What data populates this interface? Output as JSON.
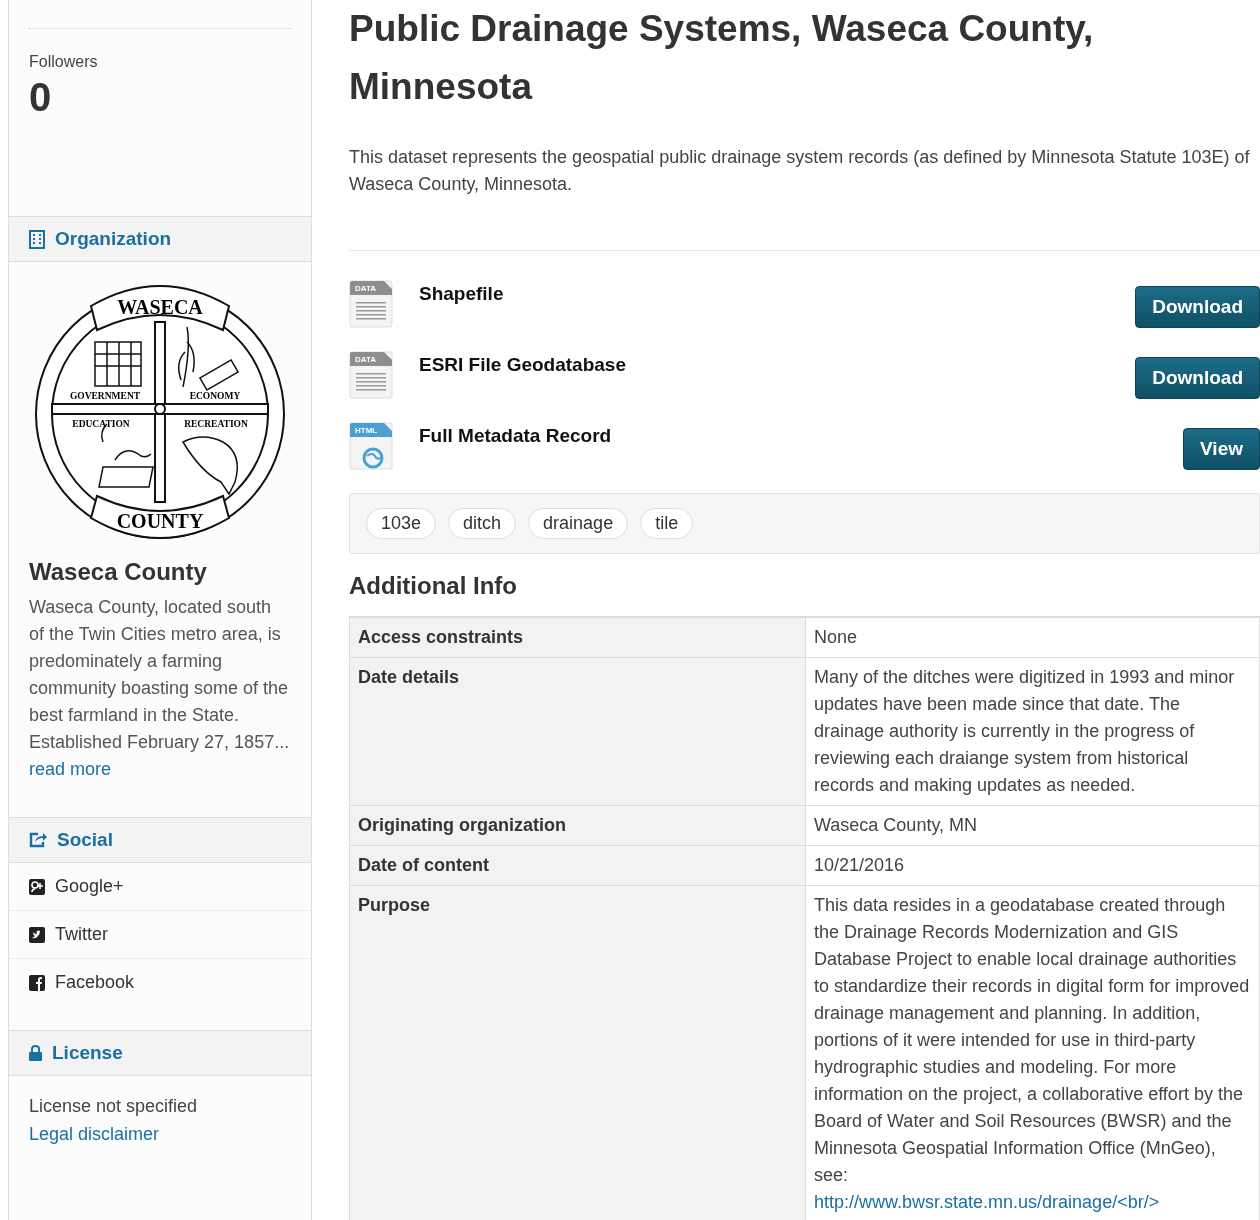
{
  "sidebar": {
    "followers": {
      "label": "Followers",
      "count": "0"
    },
    "organization": {
      "heading": "Organization",
      "seal": {
        "top": "WASECA",
        "bottom": "COUNTY",
        "quadrants": [
          "GOVERNMENT",
          "ECONOMY",
          "EDUCATION",
          "RECREATION"
        ]
      },
      "name": "Waseca County",
      "description": "Waseca County, located south of the Twin Cities metro area, is predominately a farming community boasting some of the best farmland in the State. Established February 27, 1857...",
      "more_link": "read more"
    },
    "social": {
      "heading": "Social",
      "items": [
        {
          "kind": "googleplus",
          "label": "Google+"
        },
        {
          "kind": "twitter",
          "label": "Twitter"
        },
        {
          "kind": "facebook",
          "label": "Facebook"
        }
      ]
    },
    "license": {
      "heading": "License",
      "text": "License not specified",
      "link": "Legal disclaimer"
    }
  },
  "dataset": {
    "title": "Public Drainage Systems, Waseca County, Minnesota",
    "description": "This dataset represents the geospatial public drainage system records (as defined by Minnesota Statute 103E) of Waseca County, Minnesota.",
    "resources": [
      {
        "format": "DATA",
        "name": "Shapefile",
        "action": "Download"
      },
      {
        "format": "DATA",
        "name": "ESRI File Geodatabase",
        "action": "Download"
      },
      {
        "format": "HTML",
        "name": "Full Metadata Record",
        "action": "View"
      }
    ],
    "tags": [
      "103e",
      "ditch",
      "drainage",
      "tile"
    ],
    "additional_info": {
      "heading": "Additional Info",
      "rows": [
        {
          "field": "Access constraints",
          "value": "None"
        },
        {
          "field": "Date details",
          "value": "Many of the ditches were digitized in 1993 and minor updates have been made since that date. The drainage authority is currently in the progress of reviewing each draiange system from historical records and making updates as needed."
        },
        {
          "field": "Originating organization",
          "value": "Waseca County, MN"
        },
        {
          "field": "Date of content",
          "value": "10/21/2016"
        },
        {
          "field": "Purpose",
          "value": "This data resides in a geodatabase created through the Drainage Records Modernization and GIS Database Project to enable local drainage authorities to standardize their records in digital form for improved drainage management and planning. In addition, portions of it were intended for use in third-party hydrographic studies and modeling. For more information on the project, a collaborative effort by the Board of Water and Soil Resources (BWSR) and the Minnesota Geospatial Information Office (MnGeo), see:",
          "link": "http://www.bwsr.state.mn.us/drainage/<br/>"
        }
      ]
    }
  }
}
